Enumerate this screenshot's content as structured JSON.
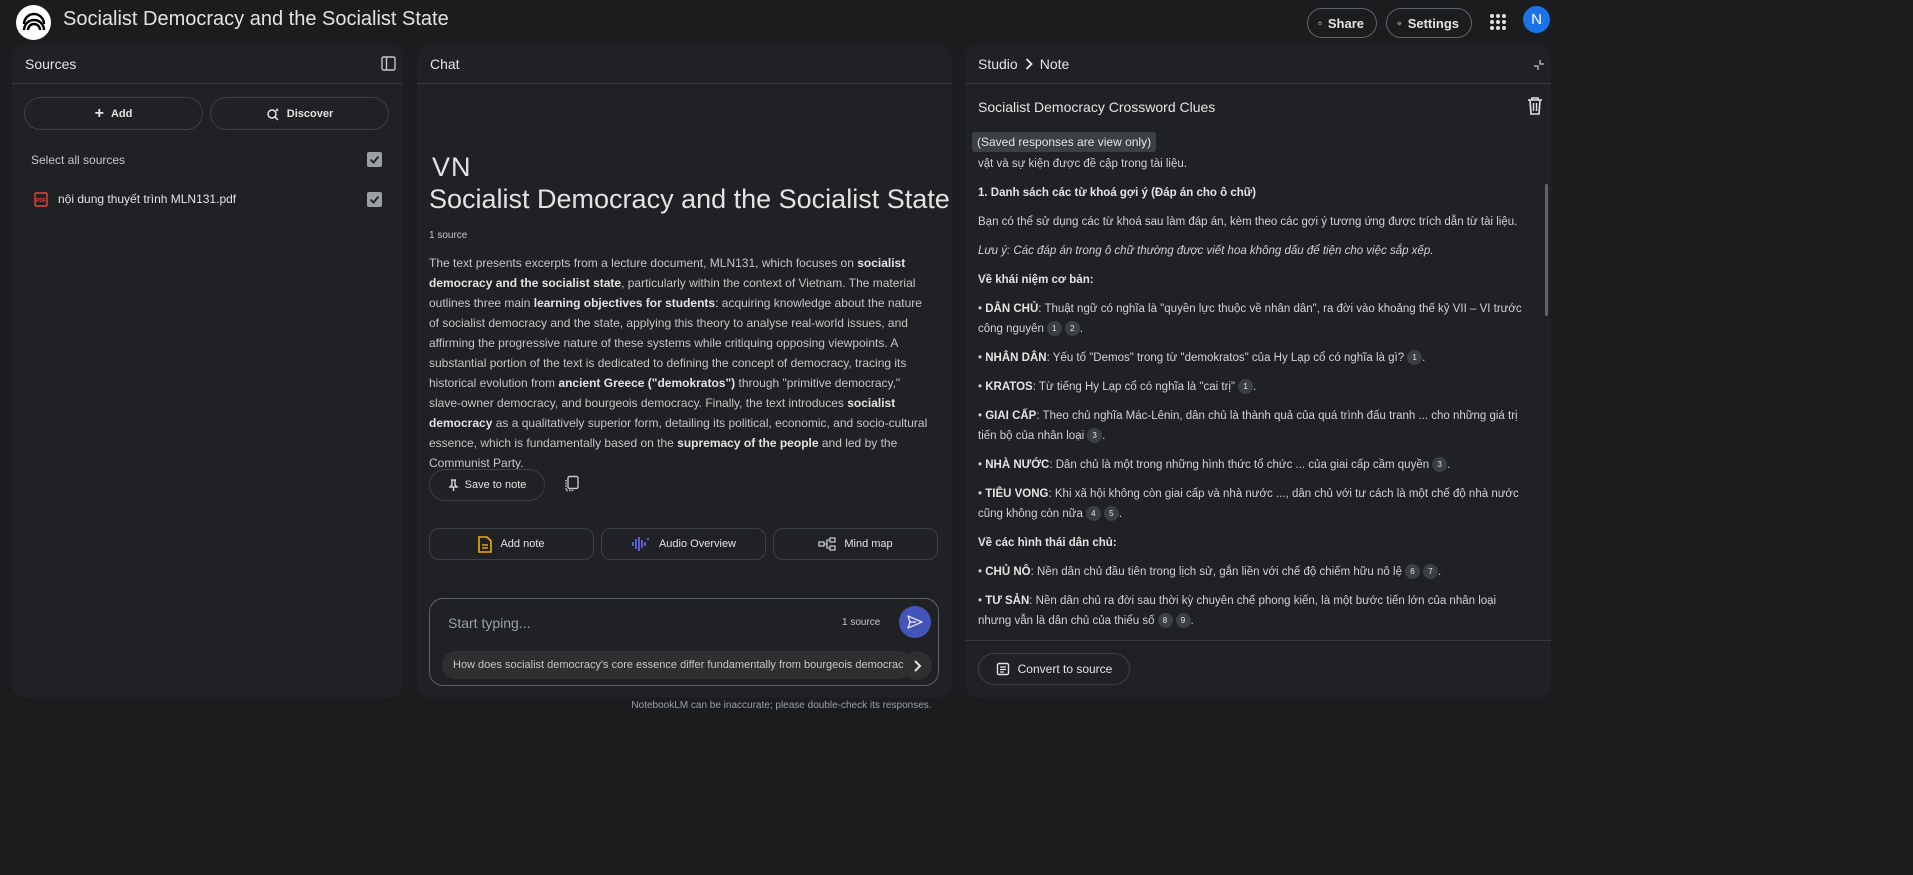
{
  "app": {
    "title": "Socialist Democracy and the Socialist State",
    "share_label": "Share",
    "settings_label": "Settings",
    "avatar_letter": "N",
    "accent_color": "#1a73e8"
  },
  "sources": {
    "header": "Sources",
    "add_label": "Add",
    "discover_label": "Discover",
    "select_all_label": "Select all sources",
    "items": [
      {
        "name": "nội dung thuyết trình MLN131.pdf",
        "icon": "pdf-icon",
        "checked": true
      }
    ]
  },
  "chat": {
    "header": "Chat",
    "badge": "VN",
    "title": "Socialist Democracy and the Socialist State",
    "source_count": "1 source",
    "summary_parts": [
      {
        "text": "The text presents excerpts from a lecture document, MLN131, which focuses on ",
        "bold": false
      },
      {
        "text": "socialist democracy and the socialist state",
        "bold": true
      },
      {
        "text": ", particularly within the context of Vietnam. The material outlines three main ",
        "bold": false
      },
      {
        "text": "learning objectives for students",
        "bold": true
      },
      {
        "text": ": acquiring knowledge about the nature of socialist democracy and the state, applying this theory to analyse real-world issues, and affirming the progressive nature of these systems while critiquing opposing viewpoints. A substantial portion of the text is dedicated to defining the concept of democracy, tracing its historical evolution from ",
        "bold": false
      },
      {
        "text": "ancient Greece (\"demokratos\")",
        "bold": true
      },
      {
        "text": " through \"primitive democracy,\" slave-owner democracy, and bourgeois democracy. Finally, the text introduces ",
        "bold": false
      },
      {
        "text": "socialist democracy",
        "bold": true
      },
      {
        "text": " as a qualitatively superior form, detailing its political, economic, and socio-cultural essence, which is fundamentally based on the ",
        "bold": false
      },
      {
        "text": "supremacy of the people",
        "bold": true
      },
      {
        "text": " and led by the Communist Party.",
        "bold": false
      }
    ],
    "save_to_note_label": "Save to note",
    "actions": {
      "add_note": "Add note",
      "audio_overview": "Audio Overview",
      "mind_map": "Mind map"
    },
    "input_placeholder": "Start typing...",
    "input_source_count": "1 source",
    "suggestion": "How does socialist democracy's core essence differ fundamentally from bourgeois democracy?"
  },
  "studio": {
    "breadcrumb_root": "Studio",
    "breadcrumb_current": "Note",
    "note_title": "Socialist Democracy Crossword Clues",
    "view_only_label": "(Saved responses are view only)",
    "note_paragraphs": [
      {
        "type": "p",
        "parts": [
          {
            "text": "vật và sự kiện được đề cập trong tài liệu."
          }
        ]
      },
      {
        "type": "p",
        "parts": [
          {
            "text": "1. Danh sách các từ khoá gợi ý (Đáp án cho ô chữ)",
            "bold": true
          }
        ]
      },
      {
        "type": "p",
        "parts": [
          {
            "text": "Bạn có thể sử dụng các từ khoá sau làm đáp án, kèm theo các gợi ý tương ứng được trích dẫn từ tài liệu."
          }
        ]
      },
      {
        "type": "p",
        "parts": [
          {
            "text": "Lưu ý: Các đáp án trong ô chữ thường được viết hoa không dấu để tiện cho việc sắp xếp.",
            "italic": true
          }
        ]
      },
      {
        "type": "p",
        "parts": [
          {
            "text": "Về khái niệm cơ bản:",
            "bold": true
          }
        ]
      },
      {
        "type": "p",
        "parts": [
          {
            "text": "• "
          },
          {
            "text": "DÂN CHỦ",
            "bold": true
          },
          {
            "text": ": Thuật ngữ có nghĩa là \"quyền lực thuộc về nhân dân\", ra đời vào khoảng thế kỷ VII – VI trước công nguyên"
          }
        ],
        "cites": [
          "1",
          "2"
        ],
        "tail": "."
      },
      {
        "type": "p",
        "parts": [
          {
            "text": "• "
          },
          {
            "text": "NHÂN DÂN",
            "bold": true
          },
          {
            "text": ": Yếu tố \"Demos\" trong từ \"demokratos\" của Hy Lạp cổ có nghĩa là gì?"
          }
        ],
        "cites": [
          "1"
        ],
        "tail": "."
      },
      {
        "type": "p",
        "parts": [
          {
            "text": "• "
          },
          {
            "text": "KRATOS",
            "bold": true
          },
          {
            "text": ": Từ tiếng Hy Lạp cổ có nghĩa là \"cai trị\""
          }
        ],
        "cites": [
          "1"
        ],
        "tail": "."
      },
      {
        "type": "p",
        "parts": [
          {
            "text": "• "
          },
          {
            "text": "GIAI CẤP",
            "bold": true
          },
          {
            "text": ": Theo chủ nghĩa Mác-Lênin, dân chủ là thành quả của quá trình đấu tranh ... cho những giá trị tiến bộ của nhân loại"
          }
        ],
        "cites": [
          "3"
        ],
        "tail": "."
      },
      {
        "type": "p",
        "parts": [
          {
            "text": "• "
          },
          {
            "text": "NHÀ NƯỚC",
            "bold": true
          },
          {
            "text": ": Dân chủ là một trong những hình thức tổ chức ... của giai cấp cầm quyền"
          }
        ],
        "cites": [
          "3"
        ],
        "tail": "."
      },
      {
        "type": "p",
        "parts": [
          {
            "text": "• "
          },
          {
            "text": "TIÊU VONG",
            "bold": true
          },
          {
            "text": ": Khi xã hội không còn giai cấp và nhà nước ..., dân chủ với tư cách là một chế độ nhà nước cũng không còn nữa"
          }
        ],
        "cites": [
          "4",
          "5"
        ],
        "tail": "."
      },
      {
        "type": "p",
        "parts": [
          {
            "text": "Về các hình thái dân chủ:",
            "bold": true
          }
        ]
      },
      {
        "type": "p",
        "parts": [
          {
            "text": "• "
          },
          {
            "text": "CHỦ NÔ",
            "bold": true
          },
          {
            "text": ": Nền dân chủ đầu tiên trong lịch sử, gắn liền với chế độ chiếm hữu nô lệ"
          }
        ],
        "cites": [
          "6",
          "7"
        ],
        "tail": "."
      },
      {
        "type": "p",
        "parts": [
          {
            "text": "• "
          },
          {
            "text": "TƯ SẢN",
            "bold": true
          },
          {
            "text": ": Nền dân chủ ra đời sau thời kỳ chuyên chế phong kiến, là một bước tiến lớn của nhân loại nhưng vẫn là dân chủ của thiểu số"
          }
        ],
        "cites": [
          "8",
          "9"
        ],
        "tail": "."
      }
    ],
    "convert_label": "Convert to source"
  },
  "footer": {
    "disclaimer": "NotebookLM can be inaccurate; please double-check its responses."
  }
}
